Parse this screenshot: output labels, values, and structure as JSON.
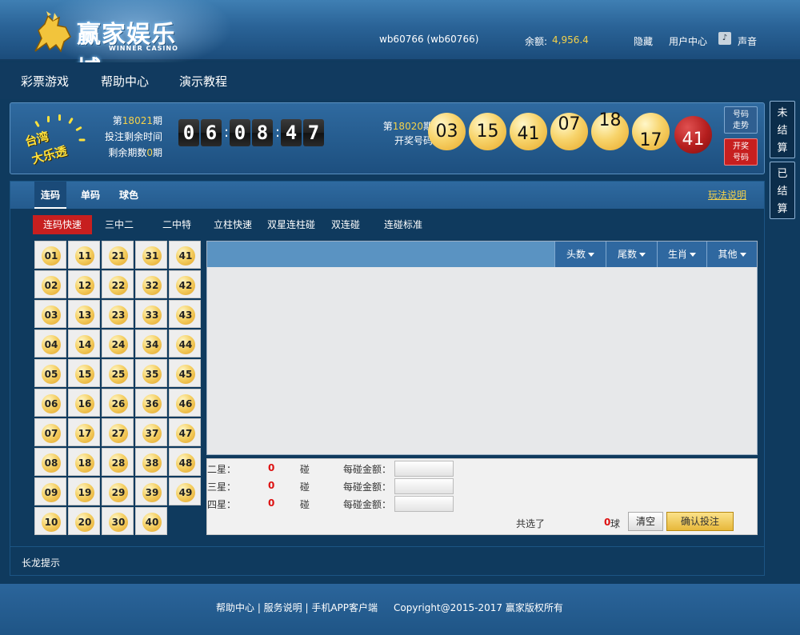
{
  "header": {
    "brand": "赢家娱乐城",
    "brand_sub": "WINNER CASINO",
    "user": "wb60766 (wb60766)",
    "balance_label": "余额:",
    "balance_value": "4,956.4",
    "hide": "隐藏",
    "user_center": "用户中心",
    "sound": "声音"
  },
  "nav": {
    "items": [
      "彩票游戏",
      "帮助中心",
      "演示教程"
    ]
  },
  "draw": {
    "logo_line1": "台湾",
    "logo_line2": "大乐透",
    "period_prefix": "第",
    "current_period": "18021",
    "period_suffix": "期",
    "time_left_label": "投注剩余时间",
    "remaining_label_a": "剩余期数",
    "remaining_count": "0",
    "remaining_label_b": "期",
    "timer": [
      "0",
      "6",
      "0",
      "8",
      "4",
      "7"
    ],
    "last_period": "18020",
    "last_label": "开奖号码",
    "balls": [
      "03",
      "15",
      "41",
      "07",
      "18",
      "17",
      "41"
    ],
    "btn_trend": "号码\n走势",
    "btn_results": "开奖\n号码"
  },
  "right_tabs": {
    "unsettled": [
      "未",
      "结",
      "算"
    ],
    "settled": [
      "已",
      "结",
      "算"
    ]
  },
  "tabs": [
    "连码",
    "单码",
    "球色"
  ],
  "rules_link": "玩法说明",
  "sub_tabs": [
    "连码快速",
    "三中二",
    "二中特",
    "立柱快速",
    "双星连柱碰",
    "双连碰",
    "连碰标准"
  ],
  "numbers": [
    [
      "01",
      "02",
      "03",
      "04",
      "05",
      "06",
      "07",
      "08",
      "09",
      "10"
    ],
    [
      "11",
      "12",
      "13",
      "14",
      "15",
      "16",
      "17",
      "18",
      "19",
      "20"
    ],
    [
      "21",
      "22",
      "23",
      "24",
      "25",
      "26",
      "27",
      "28",
      "29",
      "30"
    ],
    [
      "31",
      "32",
      "33",
      "34",
      "35",
      "36",
      "37",
      "38",
      "39",
      "40"
    ],
    [
      "41",
      "42",
      "43",
      "44",
      "45",
      "46",
      "47",
      "48",
      "49"
    ]
  ],
  "filters": [
    "头数",
    "尾数",
    "生肖",
    "其他"
  ],
  "bet_rows": [
    {
      "label": "二星：",
      "count": "0",
      "unit": "碰",
      "amount_label": "每碰金额："
    },
    {
      "label": "三星：",
      "count": "0",
      "unit": "碰",
      "amount_label": "每碰金额："
    },
    {
      "label": "四星：",
      "count": "0",
      "unit": "碰",
      "amount_label": "每碰金额："
    }
  ],
  "total_label": "共选了",
  "total_count": "0",
  "total_unit": "球",
  "clear": "清空",
  "confirm": "确认投注",
  "long_dragon": "长龙提示",
  "footer": {
    "links": "帮助中心 | 服务说明 | 手机APP客户端",
    "copyright": "Copyright@2015-2017 赢家版权所有"
  }
}
